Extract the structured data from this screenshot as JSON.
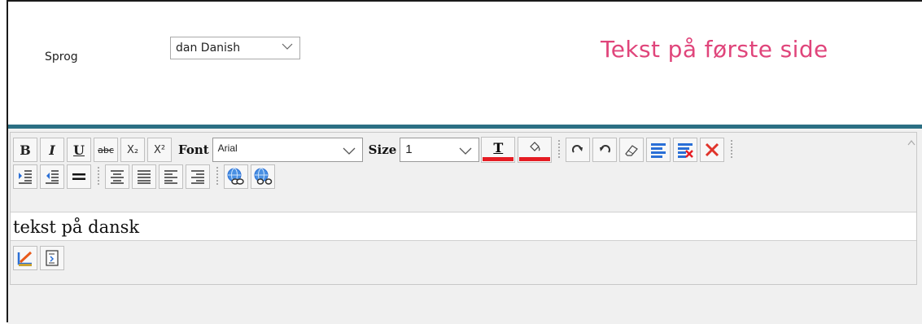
{
  "language": {
    "label": "Sprog",
    "selected": "dan Danish"
  },
  "page_title": "Tekst på første side",
  "colors": {
    "title": "#e0457b",
    "accent_bar": "#2b6f83",
    "color_swatch": "#e51c23",
    "icon_blue": "#2a6fd6"
  },
  "toolbar": {
    "bold": "B",
    "italic": "I",
    "underline": "U",
    "strike": "abc",
    "subscript": "X₂",
    "superscript": "X²",
    "font_label": "Font",
    "font_value": "Arial",
    "size_label": "Size",
    "size_value": "1",
    "text_color": "T"
  },
  "editor": {
    "content": "tekst på dansk"
  },
  "icons": [
    "bold-icon",
    "italic-icon",
    "underline-icon",
    "strikethrough-icon",
    "subscript-icon",
    "superscript-icon",
    "text-color-icon",
    "background-color-icon",
    "redo-icon",
    "undo-icon",
    "eraser-icon",
    "paragraph-icon",
    "remove-format-icon",
    "delete-icon",
    "indent-icon",
    "outdent-icon",
    "horizontal-rule-icon",
    "align-center-icon",
    "justify-icon",
    "align-left-icon",
    "align-right-icon",
    "insert-link-icon",
    "unlink-icon",
    "edit-design-icon",
    "html-source-icon"
  ]
}
